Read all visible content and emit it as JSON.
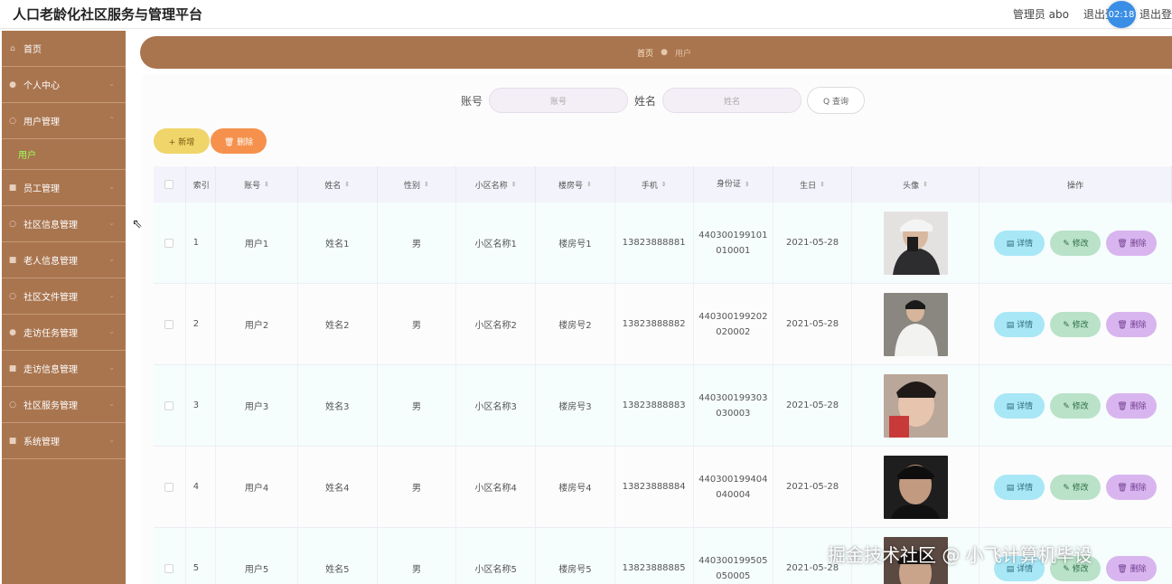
{
  "app": {
    "title": "人口老龄化社区服务与管理平台"
  },
  "header": {
    "role_user": "管理员 abo",
    "logout_1": "退出登",
    "logout_2": "退出登",
    "clock": "02:18"
  },
  "sidebar": {
    "items": [
      {
        "label": "首页",
        "icon": "home-icon",
        "glyph": "⌂"
      },
      {
        "label": "个人中心",
        "icon": "user-icon",
        "glyph": "●"
      },
      {
        "label": "用户管理",
        "icon": "users-icon",
        "glyph": "○"
      },
      {
        "label": "员工管理",
        "icon": "staff-icon",
        "glyph": "■"
      },
      {
        "label": "社区信息管理",
        "icon": "community-icon",
        "glyph": "○"
      },
      {
        "label": "老人信息管理",
        "icon": "elder-icon",
        "glyph": "■"
      },
      {
        "label": "社区文件管理",
        "icon": "file-icon",
        "glyph": "○"
      },
      {
        "label": "走访任务管理",
        "icon": "task-icon",
        "glyph": "●"
      },
      {
        "label": "走访信息管理",
        "icon": "visit-icon",
        "glyph": "■"
      },
      {
        "label": "社区服务管理",
        "icon": "service-icon",
        "glyph": "○"
      },
      {
        "label": "系统管理",
        "icon": "system-icon",
        "glyph": "■"
      }
    ],
    "sub_item": "用户"
  },
  "breadcrumb": {
    "home": "首页",
    "current": "用户"
  },
  "search": {
    "account_label": "账号",
    "account_placeholder": "账号",
    "name_label": "姓名",
    "name_placeholder": "姓名",
    "query_label": "Q 查询"
  },
  "toolbar": {
    "add_label": "+ 新增",
    "delete_label": "🗑 删除"
  },
  "table": {
    "columns": [
      "索引",
      "账号",
      "姓名",
      "性别",
      "小区名称",
      "楼房号",
      "手机",
      "身份证",
      "生日",
      "头像",
      "操作"
    ],
    "ops": {
      "detail": "▤ 详情",
      "edit": "✎ 修改",
      "delete": "🗑 删除"
    },
    "rows": [
      {
        "idx": "1",
        "account": "用户1",
        "name": "姓名1",
        "sex": "男",
        "community": "小区名称1",
        "building": "楼房号1",
        "phone": "13823888881",
        "id_a": "440300199101",
        "id_b": "010001",
        "birthday": "2021-05-28"
      },
      {
        "idx": "2",
        "account": "用户2",
        "name": "姓名2",
        "sex": "男",
        "community": "小区名称2",
        "building": "楼房号2",
        "phone": "13823888882",
        "id_a": "440300199202",
        "id_b": "020002",
        "birthday": "2021-05-28"
      },
      {
        "idx": "3",
        "account": "用户3",
        "name": "姓名3",
        "sex": "男",
        "community": "小区名称3",
        "building": "楼房号3",
        "phone": "13823888883",
        "id_a": "440300199303",
        "id_b": "030003",
        "birthday": "2021-05-28"
      },
      {
        "idx": "4",
        "account": "用户4",
        "name": "姓名4",
        "sex": "男",
        "community": "小区名称4",
        "building": "楼房号4",
        "phone": "13823888884",
        "id_a": "440300199404",
        "id_b": "040004",
        "birthday": "2021-05-28"
      },
      {
        "idx": "5",
        "account": "用户5",
        "name": "姓名5",
        "sex": "男",
        "community": "小区名称5",
        "building": "楼房号5",
        "phone": "13823888885",
        "id_a": "440300199505",
        "id_b": "050005",
        "birthday": "2021-05-28"
      }
    ]
  },
  "watermark": "掘金技术社区 @ 小飞计算机毕设"
}
